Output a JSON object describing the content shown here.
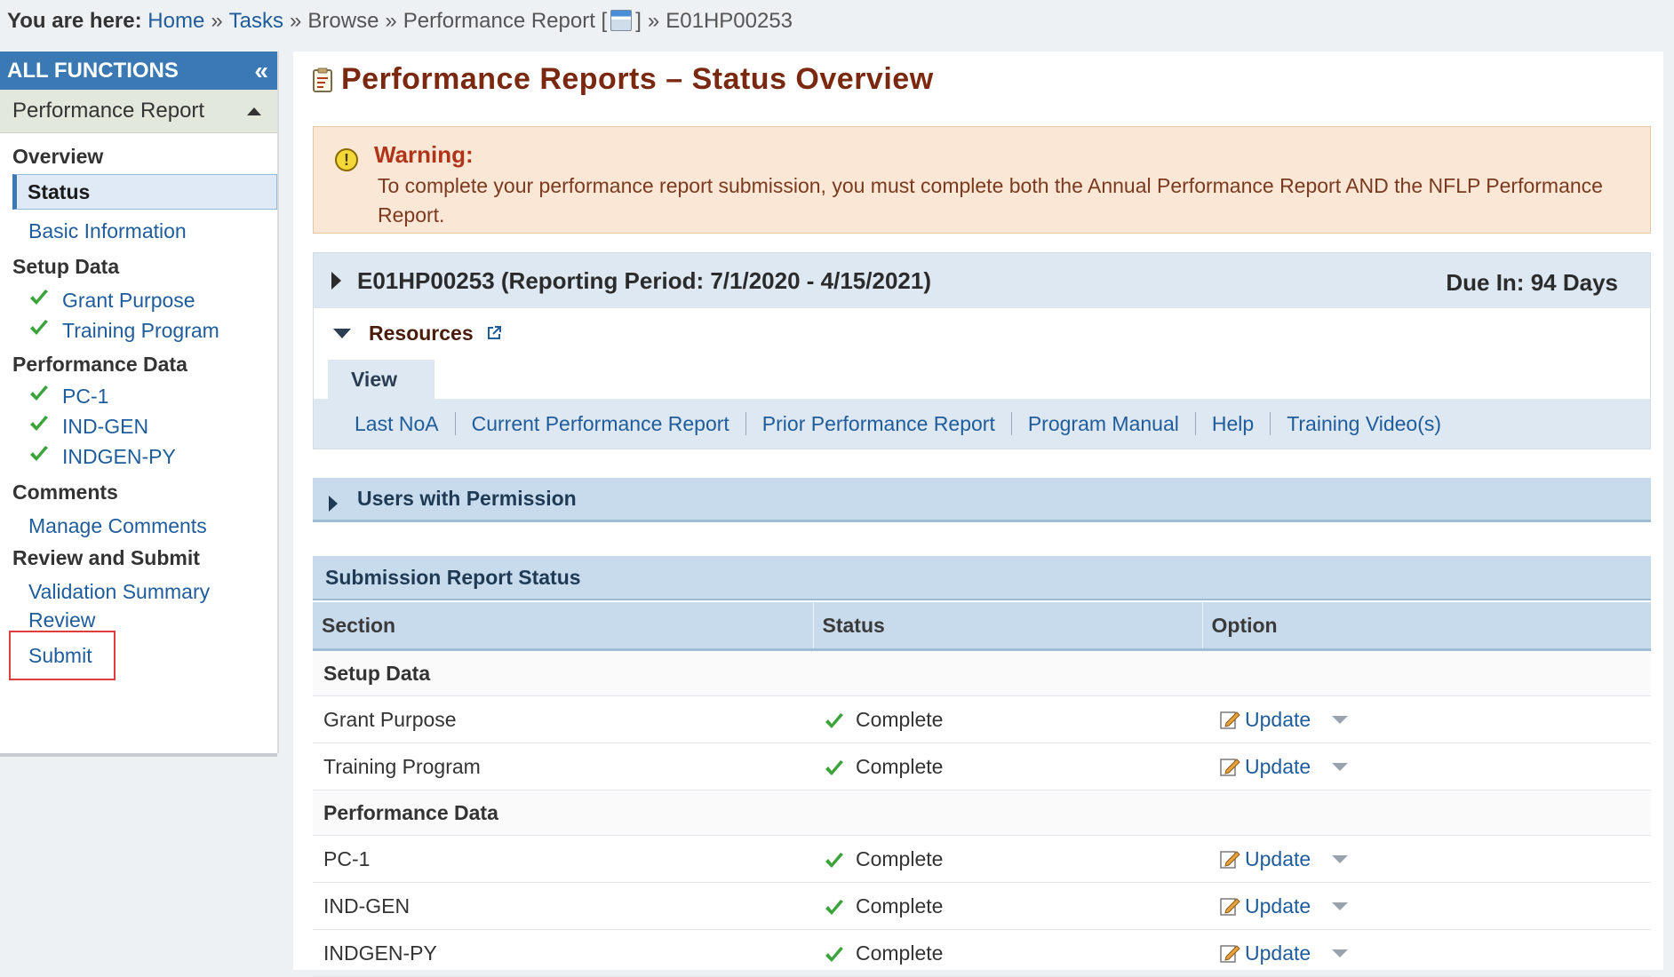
{
  "breadcrumb": {
    "lead": "You are here:",
    "home": "Home",
    "tasks": "Tasks",
    "browse": "Browse",
    "report": "Performance Report [",
    "report_close": "]",
    "current": "E01HP00253"
  },
  "sidebar": {
    "header": "ALL FUNCTIONS",
    "subheader": "Performance Report",
    "groups": [
      {
        "label": "Overview"
      },
      {
        "label": "Setup Data"
      },
      {
        "label": "Performance Data"
      },
      {
        "label": "Comments"
      },
      {
        "label": "Review and Submit"
      }
    ],
    "items": {
      "status": "Status",
      "basic_info": "Basic Information",
      "grant_purpose": "Grant Purpose",
      "training_program": "Training Program",
      "pc1": "PC-1",
      "indgen": "IND-GEN",
      "indgen_py": "INDGEN-PY",
      "manage_comments": "Manage Comments",
      "validation_summary": "Validation Summary",
      "review": "Review",
      "submit": "Submit"
    }
  },
  "page": {
    "title": "Performance Reports – Status Overview"
  },
  "warning": {
    "title": "Warning:",
    "text": "To complete your performance report submission, you must complete both the Annual Performance Report AND the NFLP Performance Report."
  },
  "period": {
    "title": "E01HP00253 (Reporting Period: 7/1/2020 - 4/15/2021)",
    "due": "Due In: 94 Days",
    "resources_label": "Resources",
    "view_tab": "View",
    "links": [
      "Last NoA",
      "Current Performance Report",
      "Prior Performance Report",
      "Program Manual",
      "Help",
      "Training Video(s)"
    ]
  },
  "users_bar": {
    "label": "Users with Permission"
  },
  "submission": {
    "title": "Submission Report Status",
    "columns": [
      "Section",
      "Status",
      "Option"
    ],
    "groups": [
      {
        "label": "Setup Data",
        "rows": [
          {
            "section": "Grant Purpose",
            "status": "Complete",
            "option": "Update"
          },
          {
            "section": "Training Program",
            "status": "Complete",
            "option": "Update"
          }
        ]
      },
      {
        "label": "Performance Data",
        "rows": [
          {
            "section": "PC-1",
            "status": "Complete",
            "option": "Update"
          },
          {
            "section": "IND-GEN",
            "status": "Complete",
            "option": "Update"
          },
          {
            "section": "INDGEN-PY",
            "status": "Complete",
            "option": "Update"
          }
        ]
      }
    ]
  },
  "colors": {
    "accent_blue": "#3a79b4",
    "title_brown": "#7a2810",
    "link_blue": "#1f5c9b",
    "check_green": "#3aa33a",
    "warning_bg": "#fbe7d5",
    "submit_highlight": "#e03c3c"
  },
  "icons": {
    "collapse": "double-chevron-left-icon",
    "check": "green-checkmark-icon",
    "external": "external-link-icon",
    "edit": "edit-pencil-icon",
    "warning": "warning-exclamation-icon"
  }
}
